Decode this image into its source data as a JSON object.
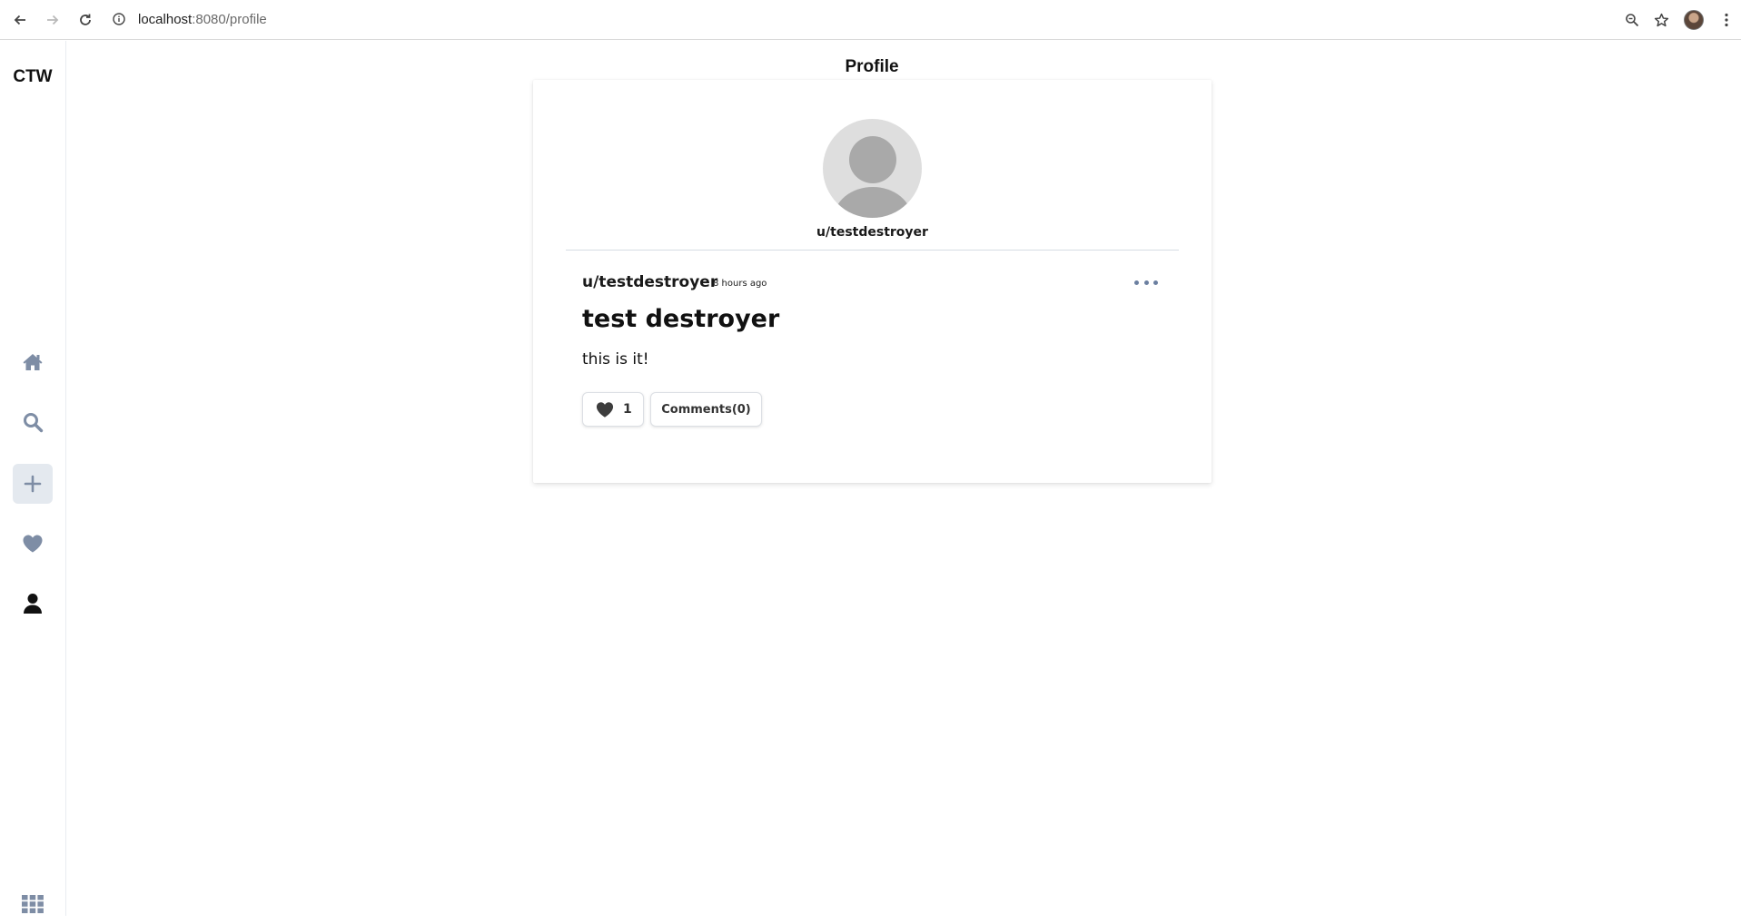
{
  "browser": {
    "url_host": "localhost",
    "url_path": ":8080/profile"
  },
  "sidebar": {
    "brand": "CTW",
    "items": [
      {
        "name": "home",
        "icon": "home-icon"
      },
      {
        "name": "search",
        "icon": "search-icon"
      },
      {
        "name": "create",
        "icon": "plus-icon",
        "active": true
      },
      {
        "name": "likes",
        "icon": "heart-icon"
      },
      {
        "name": "profile",
        "icon": "user-icon"
      }
    ],
    "bottom_icon": "grid-menu-icon"
  },
  "page": {
    "title": "Profile"
  },
  "profile": {
    "username": "u/testdestroyer"
  },
  "post": {
    "author": "u/testdestroyer",
    "time": "8 hours ago",
    "title": "test destroyer",
    "body": "this is it!",
    "likes": "1",
    "comments_label": "Comments(0)"
  },
  "colors": {
    "sidebar_icon": "#7e8da5",
    "active_bg": "#e4e9ef",
    "divider": "#d6dce3",
    "avatar_bg": "#dedede",
    "avatar_fg": "#a9a9a9"
  }
}
